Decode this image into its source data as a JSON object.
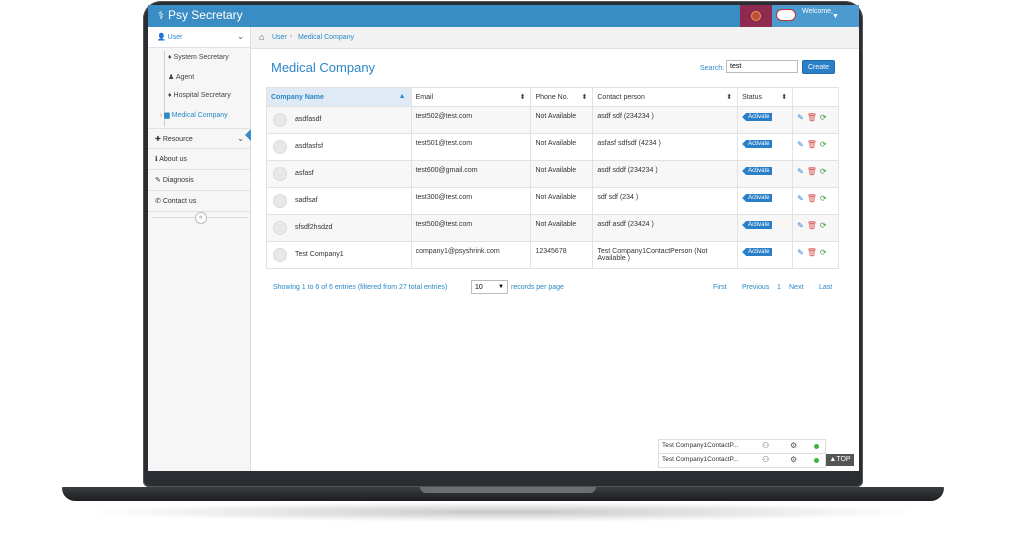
{
  "app": {
    "brand": "Psy Secretary",
    "welcome": "Welcome,"
  },
  "colors": {
    "primary": "#3a8dc4",
    "accent": "#2a7fc9",
    "delete": "#d9534f",
    "refresh": "#3c9a3c",
    "online": "#3cb43c"
  },
  "sidebar": {
    "user": "User",
    "sub_items": [
      "System Secretary",
      "Agent",
      "Hospital Secretary",
      "Medical Company"
    ],
    "resource": "Resource",
    "about": "About us",
    "diagnosis": "Diagnosis",
    "contact": "Contact us",
    "collapse": "«"
  },
  "breadcrumb": {
    "user": "User",
    "sep": "›",
    "page": "Medical Company"
  },
  "page": {
    "title": "Medical Company",
    "search_label": "Search:",
    "search_value": "test",
    "create_label": "Create"
  },
  "table": {
    "headers": [
      "Company Name",
      "Email",
      "Phone No.",
      "Contact person",
      "Status"
    ],
    "rows": [
      {
        "company": "asdfasdf",
        "email": "test502@test.com",
        "phone": "Not Available",
        "contact": "asdf sdf (234234 )",
        "status": "Activate"
      },
      {
        "company": "asdfasfsf",
        "email": "test501@test.com",
        "phone": "Not Available",
        "contact": "asfasf sdfsdf (4234 )",
        "status": "Activate"
      },
      {
        "company": "asfasf",
        "email": "test600@gmail.com",
        "phone": "Not Available",
        "contact": "asdf sddf (234234 )",
        "status": "Activate"
      },
      {
        "company": "sadfsaf",
        "email": "test300@test.com",
        "phone": "Not Available",
        "contact": "sdf sdf (234 )",
        "status": "Activate"
      },
      {
        "company": "sfsdf2hsdzd",
        "email": "test500@test.com",
        "phone": "Not Available",
        "contact": "asdf asdf (23424 )",
        "status": "Activate"
      },
      {
        "company": "Test Company1",
        "email": "company1@psyshrink.com",
        "phone": "12345678",
        "contact": "Test Company1ContactPerson (Not Available )",
        "status": "Activate"
      }
    ]
  },
  "footer": {
    "showing": "Showing 1 to 6 of 6 entries (filtered from 27 total entries)",
    "page_size": "10",
    "records_per_page": "records per page",
    "first": "First",
    "previous": "Previous",
    "current": "1",
    "next": "Next",
    "last": "Last"
  },
  "chat": {
    "items": [
      "Test Company1ContactP...",
      "Test Company1ContactP..."
    ]
  },
  "top_label": "TOP"
}
